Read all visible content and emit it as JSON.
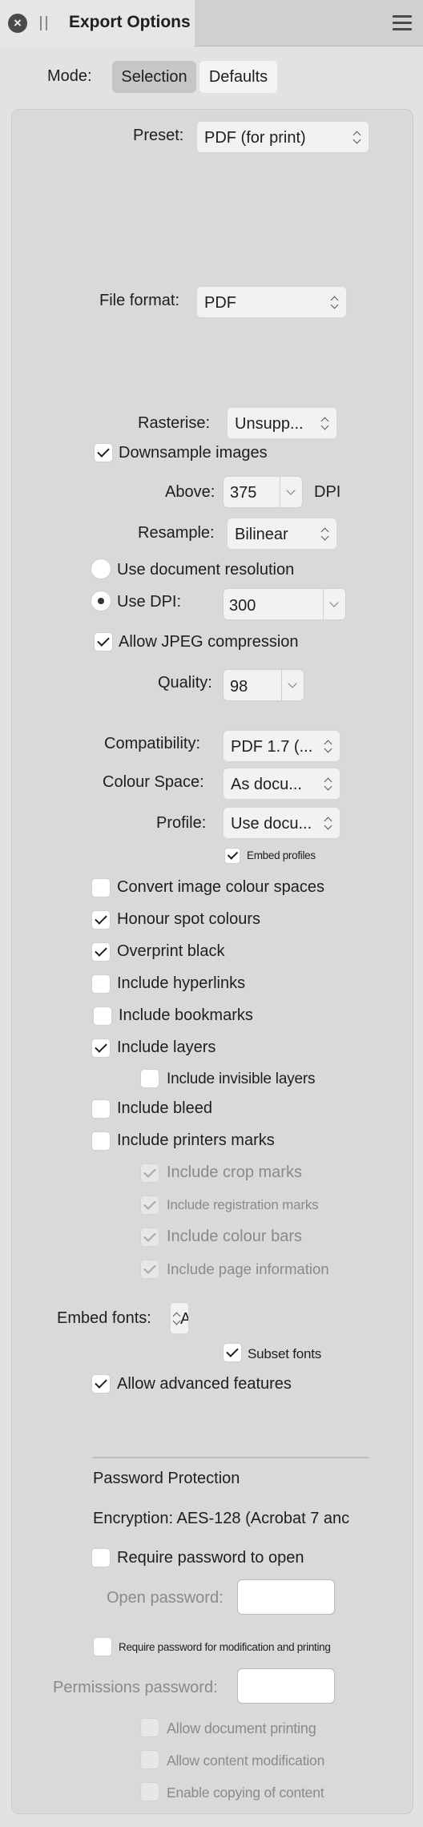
{
  "panel": {
    "title": "Export Options",
    "icons": {
      "close": "close-icon",
      "grip": "grip-icon",
      "menu": "hamburger-menu-icon"
    }
  },
  "mode": {
    "label": "Mode:",
    "options": [
      "Selection",
      "Defaults"
    ],
    "selected": "Selection"
  },
  "preset": {
    "label": "Preset:",
    "value": "PDF (for print)"
  },
  "file_format": {
    "label": "File format:",
    "value": "PDF"
  },
  "raster": {
    "rasterise_label": "Rasterise:",
    "rasterise_value": "Unsupp...",
    "downsample_label": "Downsample images",
    "downsample_checked": true,
    "above_label": "Above:",
    "above_value": "375",
    "dpi_unit": "DPI",
    "resample_label": "Resample:",
    "resample_value": "Bilinear",
    "use_doc_res_label": "Use document resolution",
    "use_doc_res_selected": false,
    "use_dpi_label": "Use DPI:",
    "use_dpi_selected": true,
    "dpi_value": "300",
    "jpeg_label": "Allow JPEG compression",
    "jpeg_checked": true,
    "quality_label": "Quality:",
    "quality_value": "98"
  },
  "output": {
    "compat_label": "Compatibility:",
    "compat_value": "PDF 1.7 (...",
    "colour_space_label": "Colour Space:",
    "colour_space_value": "As docu...",
    "profile_label": "Profile:",
    "profile_value": "Use docu...",
    "embed_profiles_label": "Embed profiles",
    "embed_profiles_checked": true
  },
  "options": [
    {
      "label": "Convert image colour spaces",
      "checked": false
    },
    {
      "label": "Honour spot colours",
      "checked": true
    },
    {
      "label": "Overprint black",
      "checked": true
    },
    {
      "label": "Include hyperlinks",
      "checked": false
    },
    {
      "label": "Include bookmarks",
      "checked": false
    },
    {
      "label": "Include layers",
      "checked": true
    },
    {
      "label": "Include invisible layers",
      "checked": false
    },
    {
      "label": "Include bleed",
      "checked": false
    },
    {
      "label": "Include printers marks",
      "checked": false
    },
    {
      "label": "Include crop marks",
      "checked": true,
      "disabled": true
    },
    {
      "label": "Include registration marks",
      "checked": true,
      "disabled": true
    },
    {
      "label": "Include colour bars",
      "checked": true,
      "disabled": true
    },
    {
      "label": "Include page information",
      "checked": true,
      "disabled": true
    }
  ],
  "fonts": {
    "embed_label": "Embed fonts:",
    "embed_value": "Al",
    "subset_label": "Subset fonts",
    "subset_checked": true,
    "advanced_label": "Allow advanced features",
    "advanced_checked": true
  },
  "password": {
    "heading": "Password Protection",
    "encryption_text": "Encryption: AES-128 (Acrobat 7 anc",
    "require_open_label": "Require password to open",
    "require_open_checked": false,
    "open_password_label": "Open password:",
    "open_password_value": "",
    "require_mod_label": "Require password for modification and printing",
    "require_mod_checked": false,
    "permissions_label": "Permissions password:",
    "permissions_value": "",
    "perm_options": [
      {
        "label": "Allow document printing",
        "checked": false
      },
      {
        "label": "Allow content modification",
        "checked": false
      },
      {
        "label": "Enable copying of content",
        "checked": false
      }
    ]
  }
}
